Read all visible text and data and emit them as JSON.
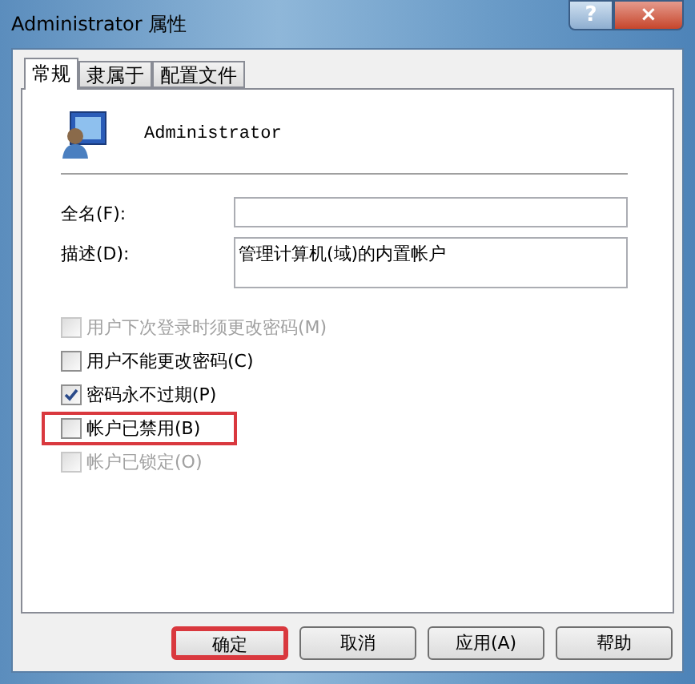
{
  "window": {
    "title": "Administrator 属性",
    "help": "?",
    "close": "×"
  },
  "tabs": [
    {
      "label": "常规",
      "selected": true
    },
    {
      "label": "隶属于",
      "selected": false
    },
    {
      "label": "配置文件",
      "selected": false
    }
  ],
  "user": {
    "name": "Administrator"
  },
  "fields": [
    {
      "label": "全名(F):",
      "multiline": false
    },
    {
      "label": "描述(D):",
      "value": "管理计算机(域)的内置帐户",
      "multiline": true
    }
  ],
  "checkboxes": [
    {
      "label": "用户下次登录时须更改密码(M)",
      "checked": false,
      "disabled": true,
      "highlighted": false
    },
    {
      "label": "用户不能更改密码(C)",
      "checked": false,
      "disabled": false,
      "highlighted": false
    },
    {
      "label": "密码永不过期(P)",
      "checked": true,
      "disabled": false,
      "highlighted": false
    },
    {
      "label": "帐户已禁用(B)",
      "checked": false,
      "disabled": false,
      "highlighted": true
    },
    {
      "label": "帐户已锁定(O)",
      "checked": false,
      "disabled": true,
      "highlighted": false
    }
  ],
  "buttons": [
    {
      "label": "确定",
      "highlighted": true
    },
    {
      "label": "取消",
      "highlighted": false
    },
    {
      "label": "应用(A)",
      "highlighted": false
    },
    {
      "label": "帮助",
      "highlighted": false
    }
  ]
}
